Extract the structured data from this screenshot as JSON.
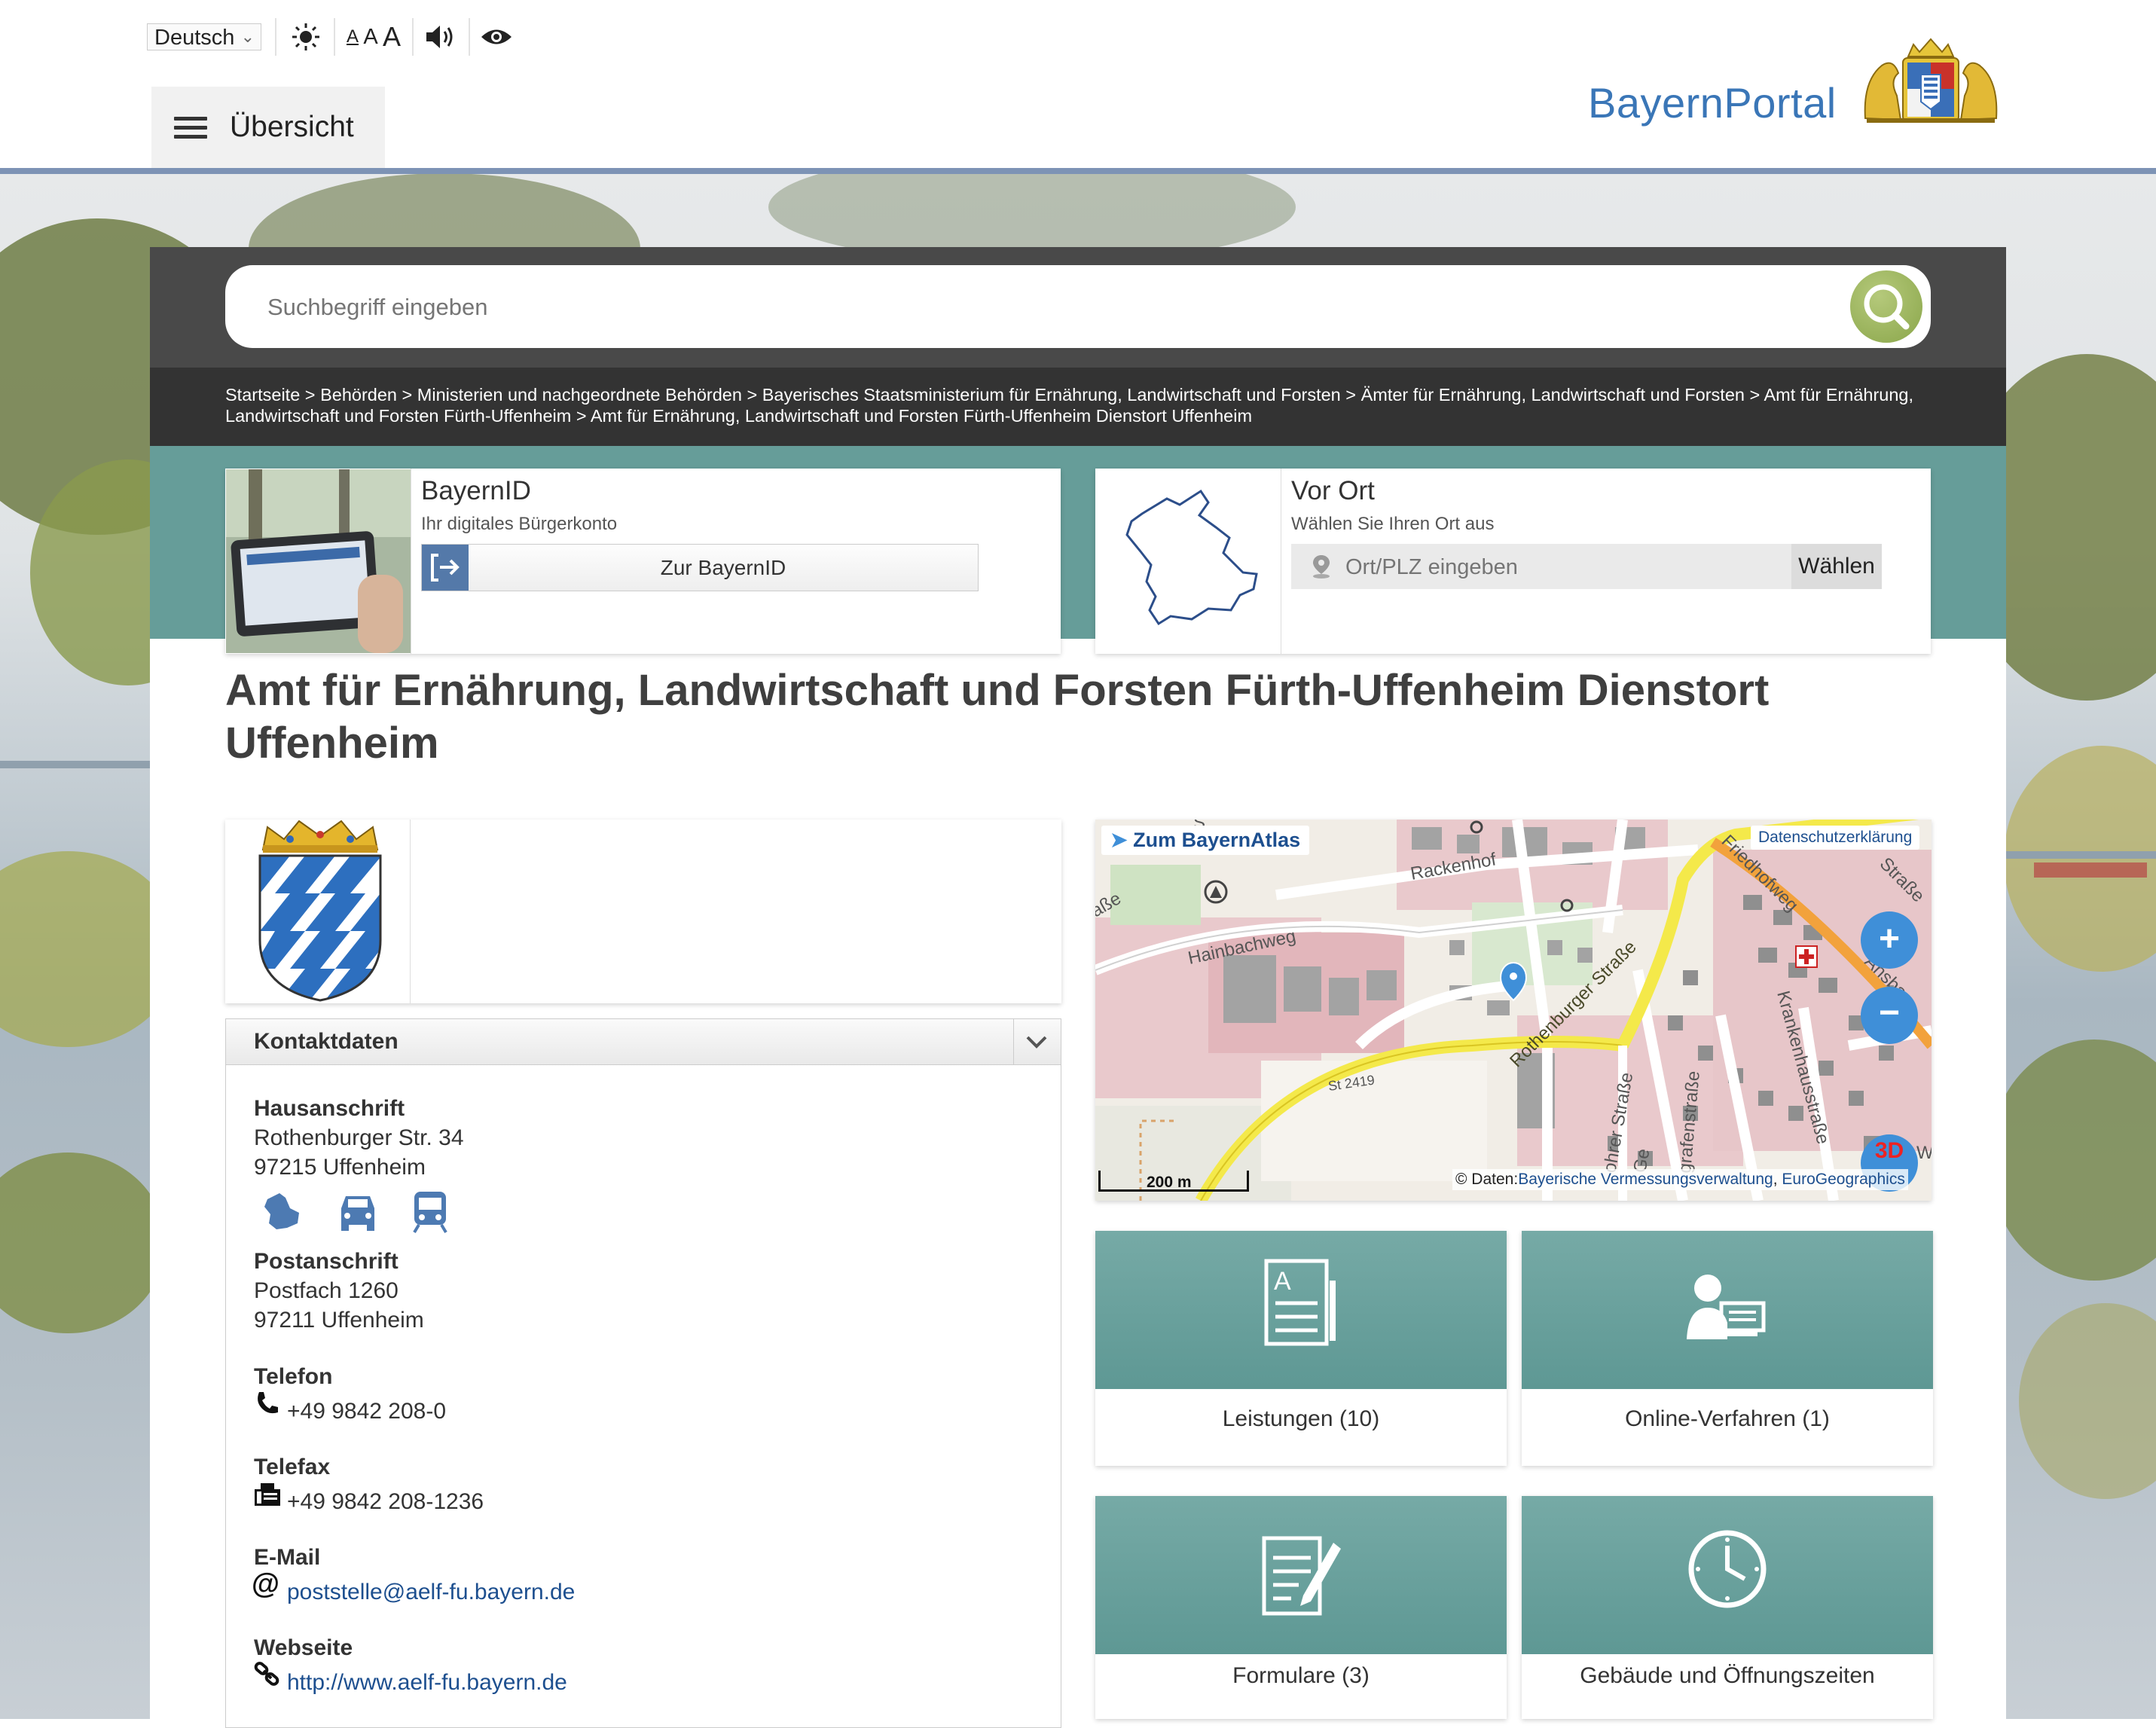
{
  "toolbar": {
    "language": "Deutsch",
    "font_sizes": [
      "A",
      "A",
      "A"
    ]
  },
  "nav": {
    "menu_label": "Übersicht"
  },
  "brand": {
    "name": "BayernPortal",
    "color": "#3a76b7"
  },
  "search": {
    "placeholder": "Suchbegriff eingeben"
  },
  "breadcrumb": [
    "Startseite",
    "Behörden",
    "Ministerien und nachgeordnete Behörden",
    "Bayerisches Staatsministerium für Ernährung, Landwirtschaft und Forsten",
    "Ämter für Ernährung, Landwirtschaft und Forsten",
    "Amt für Ernährung, Landwirtschaft und Forsten Fürth-Uffenheim",
    "Amt für Ernährung, Landwirtschaft und Forsten Fürth-Uffenheim Dienstort Uffenheim"
  ],
  "bayernid": {
    "title": "BayernID",
    "subtitle": "Ihr digitales Bürgerkonto",
    "button": "Zur BayernID"
  },
  "vorort": {
    "title": "Vor Ort",
    "subtitle": "Wählen Sie Ihren Ort aus",
    "placeholder": "Ort/PLZ eingeben",
    "button": "Wählen"
  },
  "page_title": "Amt für Ernährung, Landwirtschaft und Forsten Fürth-Uffenheim Dienstort Uffenheim",
  "contact": {
    "header": "Kontaktdaten",
    "house_label": "Hausanschrift",
    "house_street": "Rothenburger Str. 34",
    "house_city": "97215 Uffenheim",
    "post_label": "Postanschrift",
    "post_box": "Postfach 1260",
    "post_city": "97211 Uffenheim",
    "phone_label": "Telefon",
    "phone": "+49 9842 208-0",
    "fax_label": "Telefax",
    "fax": "+49 9842 208-1236",
    "email_label": "E-Mail",
    "email": "poststelle@aelf-fu.bayern.de",
    "web_label": "Webseite",
    "web": "http://www.aelf-fu.bayern.de"
  },
  "map": {
    "atlas_link": "Zum BayernAtlas",
    "privacy": "Datenschutzerklärung",
    "scale": "200 m",
    "attribution_prefix": "© Daten:",
    "attribution_1": "Bayerische Vermessungsverwaltung",
    "attribution_sep": ",",
    "attribution_2": "EuroGeographics",
    "zoom_in": "+",
    "zoom_out": "−",
    "badge_3d": "3D",
    "streets": {
      "rackenhof": "Rackenhof",
      "hainbachweg": "Hainbachweg",
      "rothenburger": "Rothenburger Straße",
      "st2419": "St 2419",
      "friedhofweg": "Friedhofweg",
      "krankenhaus": "Krankenhausstraße",
      "ansbacher": "Ansba",
      "grafenstrasse": "grafenstraße",
      "ohrer": "ohrer Straße",
      "strasse_r": "Straße",
      "ge": "Ge",
      "sse": "aße",
      "w": "W",
      "s": "S"
    }
  },
  "tiles": [
    {
      "label": "Leistungen (10)",
      "icon": "document-list-icon"
    },
    {
      "label": "Online-Verfahren (1)",
      "icon": "person-computer-icon"
    },
    {
      "label": "Formulare (3)",
      "icon": "form-pen-icon"
    },
    {
      "label": "Gebäude und Öffnungszeiten",
      "icon": "clock-icon"
    }
  ],
  "colors": {
    "teal": "#669d99",
    "link": "#1d4f8f",
    "accent_bar": "#7d93b5",
    "dark_panel": "#494949"
  }
}
